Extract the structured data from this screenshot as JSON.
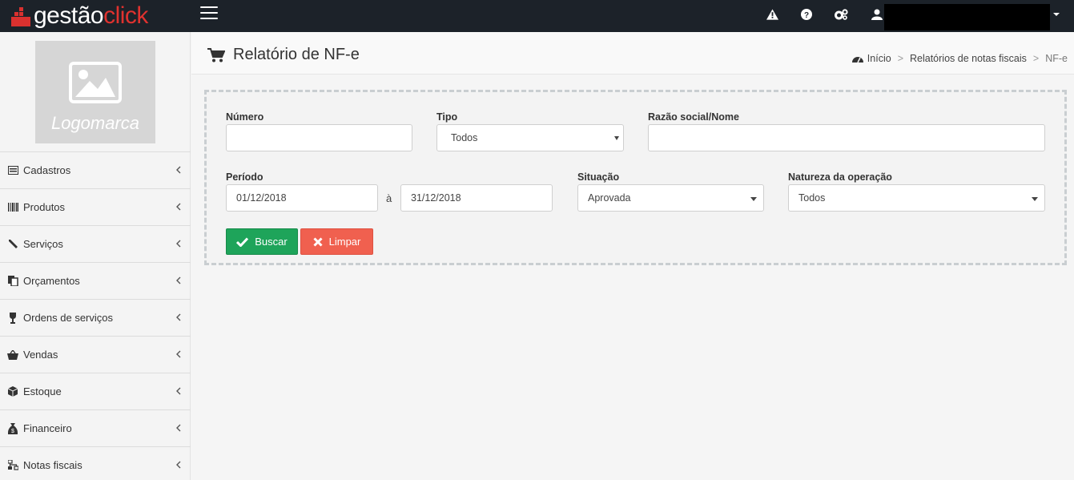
{
  "app": {
    "logo_white": "gestão",
    "logo_red": "click"
  },
  "sidebar": {
    "logo_placeholder": "Logomarca",
    "items": [
      {
        "label": "Cadastros",
        "icon": "id-card-icon"
      },
      {
        "label": "Produtos",
        "icon": "barcode-icon"
      },
      {
        "label": "Serviços",
        "icon": "wrench-icon"
      },
      {
        "label": "Orçamentos",
        "icon": "copy-icon"
      },
      {
        "label": "Ordens de serviços",
        "icon": "trophy-icon"
      },
      {
        "label": "Vendas",
        "icon": "basket-icon"
      },
      {
        "label": "Estoque",
        "icon": "cube-icon"
      },
      {
        "label": "Financeiro",
        "icon": "money-bag-icon"
      },
      {
        "label": "Notas fiscais",
        "icon": "sitemap-icon"
      }
    ]
  },
  "header": {
    "title": "Relatório de NF-e",
    "breadcrumb": [
      "Início",
      "Relatórios de notas fiscais",
      "NF-e"
    ]
  },
  "form": {
    "numero_label": "Número",
    "numero_value": "",
    "tipo_label": "Tipo",
    "tipo_value": "Todos",
    "razao_label": "Razão social/Nome",
    "razao_value": "",
    "periodo_label": "Período",
    "periodo_inicio": "01/12/2018",
    "periodo_sep": "à",
    "periodo_fim": "31/12/2018",
    "situacao_label": "Situação",
    "situacao_value": "Aprovada",
    "natureza_label": "Natureza da operação",
    "natureza_value": "Todos",
    "buscar_label": "Buscar",
    "limpar_label": "Limpar"
  },
  "colors": {
    "topbar": "#1c2229",
    "brand_red": "#e0322f",
    "success": "#1ea45a",
    "danger": "#f0604f"
  }
}
